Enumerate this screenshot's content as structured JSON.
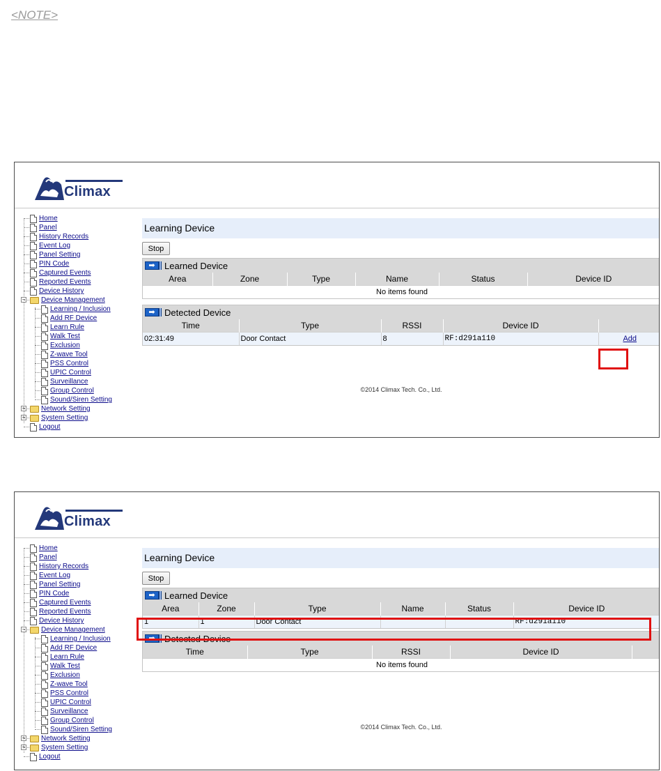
{
  "note": "<NOTE>",
  "brand": "Climax",
  "menu": {
    "home": "Home",
    "panel": "Panel",
    "history_records": "History Records",
    "event_log": "Event Log",
    "panel_setting": "Panel Setting",
    "pin_code": "PIN Code",
    "captured_events": "Captured Events",
    "reported_events": "Reported Events",
    "device_history": "Device History",
    "device_management": "Device Management",
    "learning_inclusion": "Learning / Inclusion",
    "add_rf_device": "Add RF Device",
    "learn_rule": "Learn Rule",
    "walk_test": "Walk Test",
    "exclusion": "Exclusion",
    "zwave_tool": "Z-wave Tool",
    "pss_control": "PSS Control",
    "upic_control": "UPIC Control",
    "surveillance": "Surveillance",
    "group_control": "Group Control",
    "sound_siren_setting": "Sound/Siren Setting",
    "network_setting": "Network Setting",
    "system_setting": "System Setting",
    "logout": "Logout"
  },
  "page_title": "Learning Device",
  "stop_label": "Stop",
  "learned_title": "Learned Device",
  "detected_title": "Detected Device",
  "learned_cols": [
    "Area",
    "Zone",
    "Type",
    "Name",
    "Status",
    "Device ID"
  ],
  "detected_cols": [
    "Time",
    "Type",
    "RSSI",
    "Device ID"
  ],
  "no_items": "No items found",
  "shot1": {
    "detected_row": {
      "time": "02:31:49",
      "type": "Door Contact",
      "rssi": "8",
      "device_id": "RF:d291a110",
      "action": "Add"
    }
  },
  "shot2": {
    "learned_row": {
      "area": "1",
      "zone": "1",
      "type": "Door Contact",
      "name": "",
      "status": "",
      "device_id": "RF:d291a110"
    }
  },
  "footer": "©2014 Climax Tech. Co., Ltd.",
  "colors": {
    "highlight": "#e01010",
    "brand": "#23387a",
    "title_bg": "#e6eefa"
  }
}
